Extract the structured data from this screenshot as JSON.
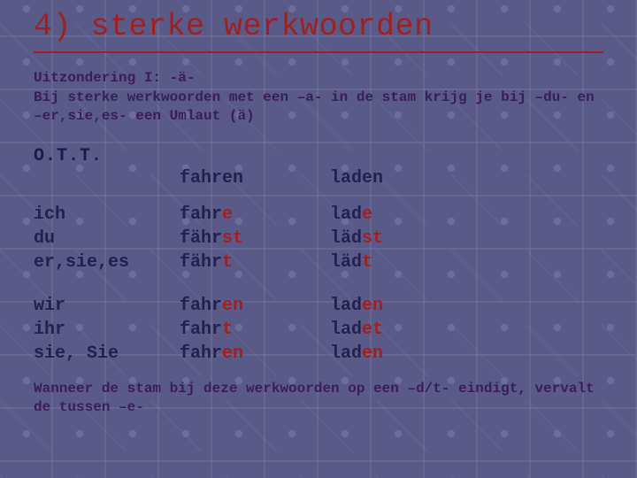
{
  "title": "4) sterke werkwoorden",
  "intro_line1": "Uitzondering I: -ä-",
  "intro_line2": "Bij sterke werkwoorden met een –a- in de stam krijg je bij –du- en –er,sie,es- een Umlaut (ä)",
  "ott": "O.T.T.",
  "headers": {
    "pron": "",
    "v1": "fahren",
    "v2": "laden"
  },
  "rows1": [
    {
      "pron": "ich",
      "s1": "fahr",
      "e1": "e",
      "s2": "lad",
      "e2": "e"
    },
    {
      "pron": "du",
      "s1": "fähr",
      "e1": "st",
      "s2": "läd",
      "e2": "st"
    },
    {
      "pron": "er,sie,es",
      "s1": "fähr",
      "e1": "t",
      "s2": "läd",
      "e2": "t"
    }
  ],
  "rows2": [
    {
      "pron": "wir",
      "s1": "fahr",
      "e1": "en",
      "s2": "lad",
      "e2": "en"
    },
    {
      "pron": "ihr",
      "s1": "fahr",
      "e1": "t",
      "s2": "lad",
      "e2": "et"
    },
    {
      "pron": "sie, Sie",
      "s1": "fahr",
      "e1": "en",
      "s2": "lad",
      "e2": "en"
    }
  ],
  "footer": "Wanneer de stam bij deze werkwoorden op een –d/t- eindigt, vervalt de tussen –e-"
}
